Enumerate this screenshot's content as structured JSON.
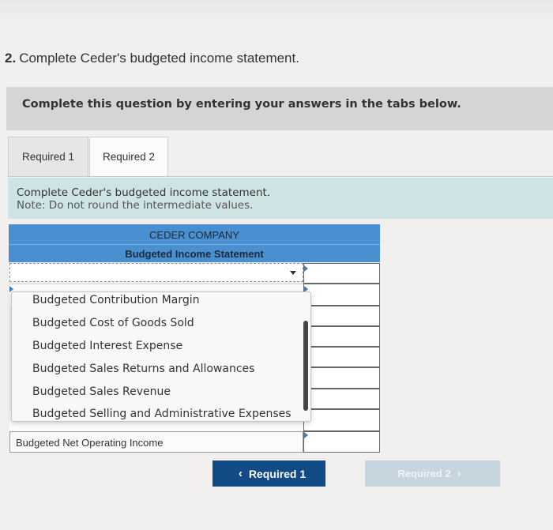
{
  "question": {
    "number": "2.",
    "text": "Complete Ceder's budgeted income statement."
  },
  "banner": "Complete this question by entering your answers in the tabs below.",
  "tabs": [
    "Required 1",
    "Required 2"
  ],
  "instructions": {
    "line1": "Complete Ceder's budgeted income statement.",
    "line2": "Note: Do not round the intermediate values."
  },
  "table": {
    "company": "CEDER COMPANY",
    "statement": "Budgeted Income Statement",
    "selected_value": "",
    "last_row_label": "Budgeted Net Operating Income"
  },
  "dropdown_options": [
    "Budgeted Contribution Margin",
    "Budgeted Cost of Goods Sold",
    "Budgeted Interest Expense",
    "Budgeted Sales Returns and Allowances",
    "Budgeted Sales Revenue",
    "Budgeted Selling and Administrative Expenses"
  ],
  "nav": {
    "prev_label": "Required 1",
    "next_label": "Required 2"
  },
  "icons": {
    "prev": "chevron-left-icon",
    "next": "chevron-right-icon",
    "dropdown": "caret-down-icon"
  },
  "colors": {
    "table_header": "#4a90d1",
    "prev_button": "#124a85",
    "instructions_bg": "#cde3e4"
  }
}
